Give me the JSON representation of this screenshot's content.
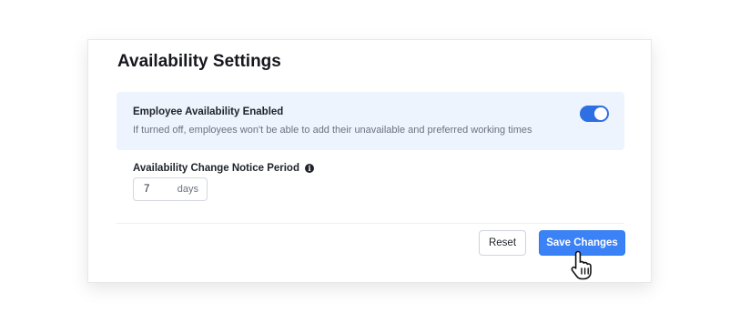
{
  "title": "Availability Settings",
  "availability": {
    "label": "Employee Availability Enabled",
    "description": "If turned off, employees won't be able to add their unavailable and preferred working times",
    "enabled": true
  },
  "notice": {
    "label": "Availability Change Notice Period",
    "value": "7",
    "unit": "days"
  },
  "actions": {
    "reset_label": "Reset",
    "save_label": "Save Changes"
  },
  "colors": {
    "accent": "#3b82f6",
    "toggle_on": "#2f6fe4",
    "panel_bg": "#eef4fd"
  },
  "icons": {
    "info": "info-icon",
    "cursor": "hand-pointer-icon"
  }
}
